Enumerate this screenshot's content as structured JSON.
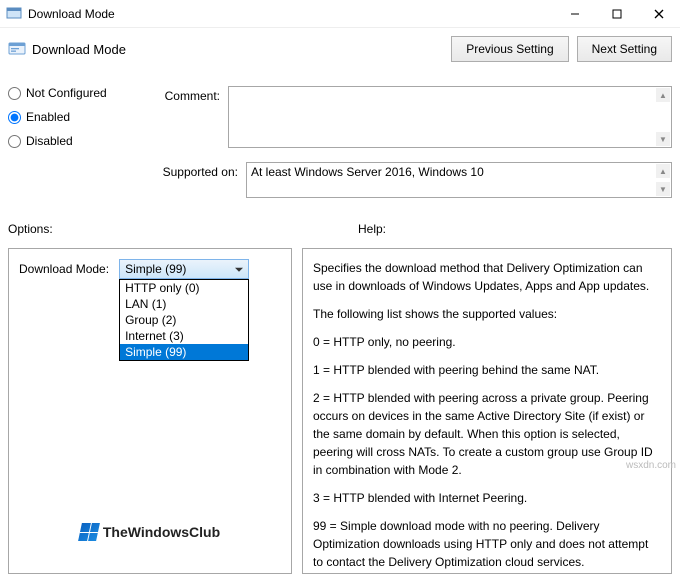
{
  "window": {
    "title": "Download Mode"
  },
  "header": {
    "subtitle": "Download Mode",
    "previous_btn": "Previous Setting",
    "next_btn": "Next Setting"
  },
  "radios": {
    "not_configured": "Not Configured",
    "enabled": "Enabled",
    "disabled": "Disabled",
    "selected": "enabled"
  },
  "fields": {
    "comment_label": "Comment:",
    "comment_value": "",
    "supported_label": "Supported on:",
    "supported_value": "At least Windows Server 2016, Windows 10"
  },
  "section_labels": {
    "options": "Options:",
    "help": "Help:"
  },
  "options_panel": {
    "label": "Download Mode:",
    "selected": "Simple (99)",
    "items": [
      "HTTP only (0)",
      "LAN (1)",
      "Group (2)",
      "Internet (3)",
      "Simple (99)"
    ],
    "highlighted_index": 4
  },
  "help_text": {
    "p1": "Specifies the download method that Delivery Optimization can use in downloads of Windows Updates, Apps and App updates.",
    "p2": "The following list shows the supported values:",
    "p3": "0 = HTTP only, no peering.",
    "p4": "1 = HTTP blended with peering behind the same NAT.",
    "p5": "2 = HTTP blended with peering across a private group. Peering occurs on devices in the same Active Directory Site (if exist) or the same domain by default. When this option is selected, peering will cross NATs. To create a custom group use Group ID in combination with Mode 2.",
    "p6": "3 = HTTP blended with Internet Peering.",
    "p7": "99 = Simple download mode with no peering. Delivery Optimization downloads using HTTP only and does not attempt to contact the Delivery Optimization cloud services."
  },
  "branding": {
    "logo_text": "TheWindowsClub"
  },
  "watermark": "wsxdn.com"
}
